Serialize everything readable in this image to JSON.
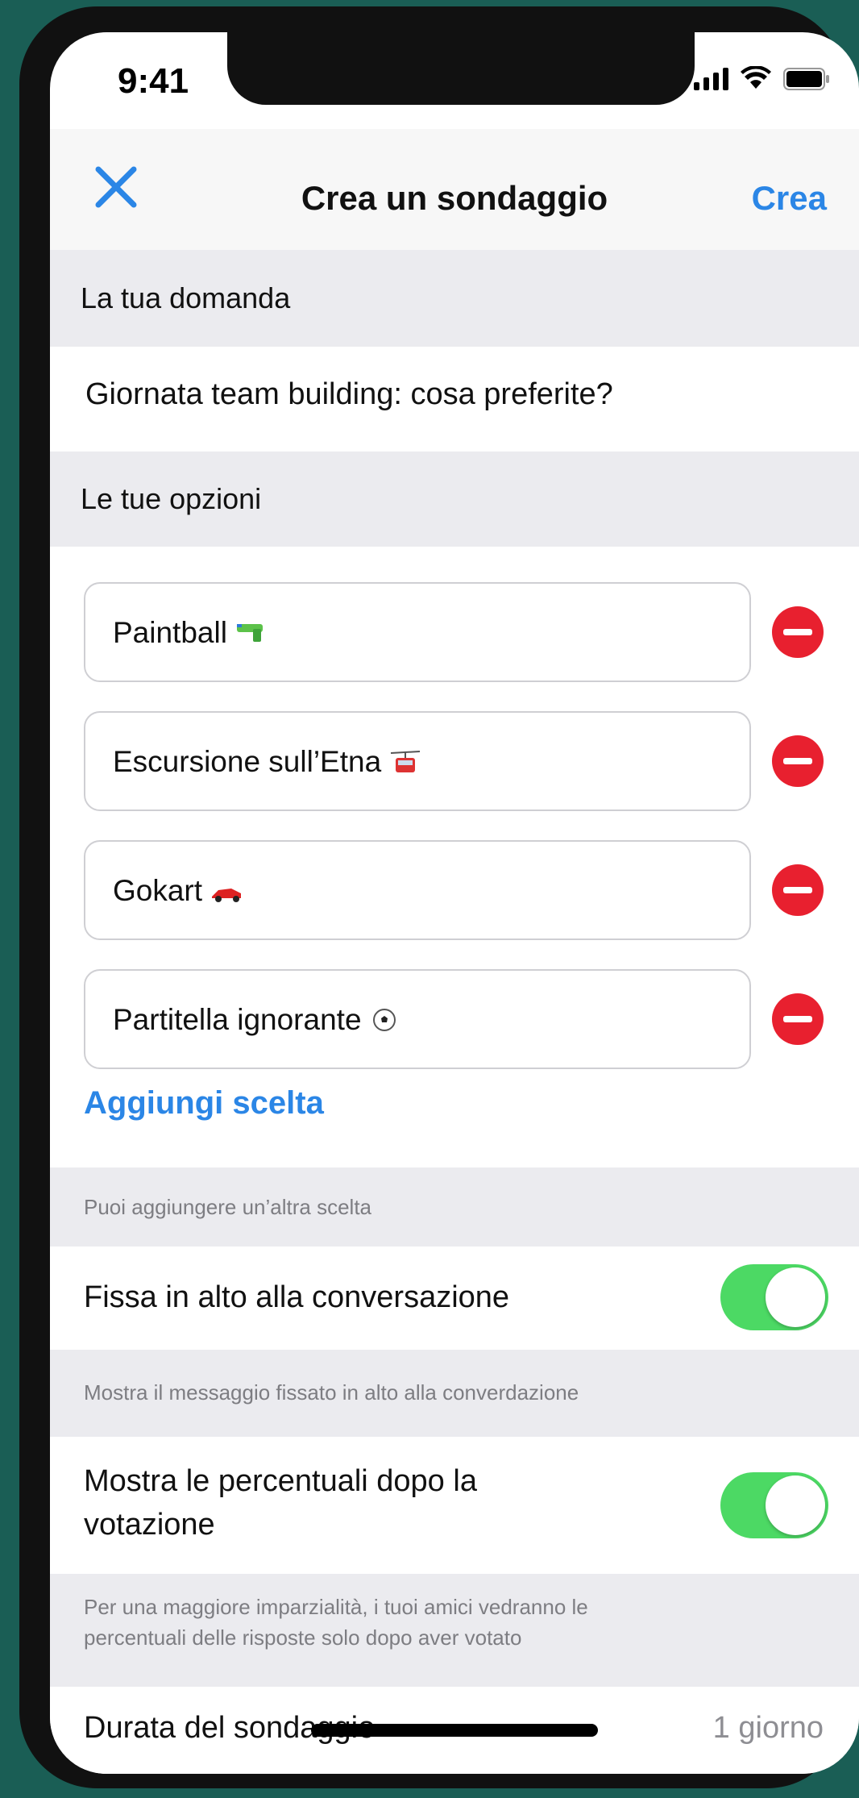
{
  "status_bar": {
    "time": "9:41"
  },
  "nav": {
    "title": "Crea un sondaggio",
    "action": "Crea"
  },
  "question": {
    "header": "La tua domanda",
    "value": "Giornata team building: cosa preferite?"
  },
  "options": {
    "header": "Le tue opzioni",
    "items": [
      {
        "label": "Paintball",
        "emoji_icon": "water-pistol-icon"
      },
      {
        "label": "Escursione sull’Etna",
        "emoji_icon": "aerial-tramway-icon"
      },
      {
        "label": "Gokart",
        "emoji_icon": "racing-car-icon"
      },
      {
        "label": "Partitella ignorante",
        "emoji_icon": "soccer-ball-icon"
      }
    ],
    "add_label": "Aggiungi scelta",
    "add_hint": "Puoi aggiungere un’altra scelta"
  },
  "settings": {
    "pin": {
      "label": "Fissa in alto alla conversazione",
      "enabled": true,
      "hint": "Mostra il messaggio fissato in alto alla converdazione"
    },
    "percentages": {
      "label_line1": "Mostra le percentuali dopo la",
      "label_line2": "votazione",
      "enabled": true,
      "hint_line1": "Per una maggiore imparzialità, i tuoi amici vedranno le",
      "hint_line2": "percentuali delle risposte solo dopo aver votato"
    },
    "duration": {
      "label": "Durata del sondaggio",
      "value": "1 giorno"
    }
  },
  "colors": {
    "accent": "#2b86e6",
    "toggle_on": "#4cd964",
    "remove": "#e8202f",
    "background": "#1a5e55"
  }
}
